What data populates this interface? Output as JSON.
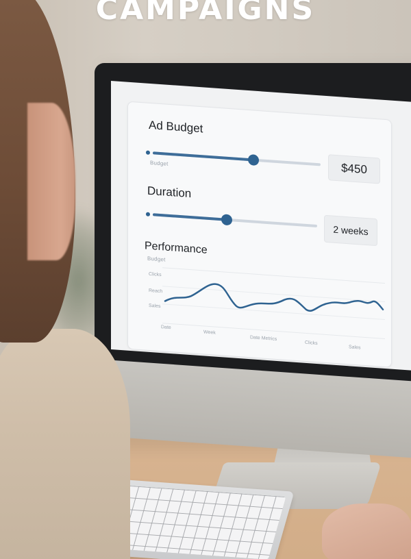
{
  "banner": {
    "title": "CAMPAIGNS"
  },
  "dashboard": {
    "ad_budget": {
      "label": "Ad Budget",
      "slider_value": 0.6,
      "value_text": "$450",
      "caption": "Budget"
    },
    "duration": {
      "label": "Duration",
      "slider_value": 0.45,
      "value_text": "2 weeks"
    },
    "performance": {
      "label": "Performance",
      "y_ticks": [
        "Clicks",
        "Reach",
        "Sales"
      ],
      "legend_hint": "Budget",
      "x_ticks": [
        "Date",
        "Week",
        "Date Metrics",
        "Clicks",
        "Sales"
      ]
    }
  },
  "colors": {
    "accent": "#2f6391",
    "track": "#cfd6de",
    "title_text": "#ffffff"
  }
}
